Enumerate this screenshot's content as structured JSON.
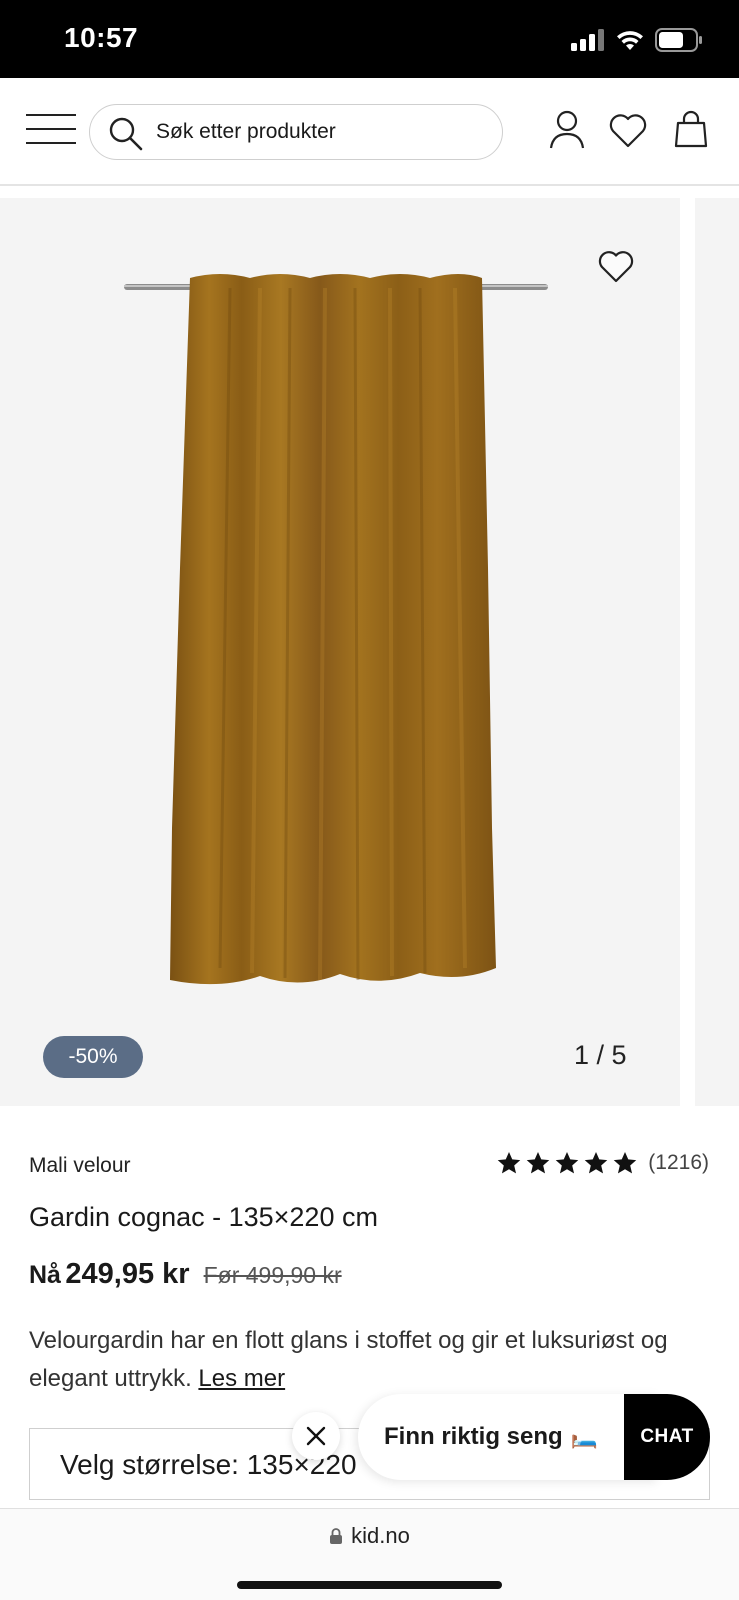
{
  "status_bar": {
    "time": "10:57"
  },
  "header": {
    "search_placeholder": "Søk etter produkter"
  },
  "gallery": {
    "discount": "-50%",
    "pager": "1 / 5"
  },
  "product": {
    "brand": "Mali velour",
    "rating_value": 5,
    "rating_count": "(1216)",
    "title": "Gardin cognac - 135×220 cm",
    "price_now_label": "Nå",
    "price_now": "249,95 kr",
    "price_before": "Før 499,90 kr",
    "description": "Velourgardin har en flott glans i stoffet og gir et luksuriøst og elegant uttrykk.",
    "read_more": "Les mer",
    "size_select_text": "Velg størrelse: 135×220"
  },
  "floating": {
    "finn_label": "Finn riktig seng",
    "finn_emoji": "🛏️",
    "chat_label": "CHAT"
  },
  "browser": {
    "url": "kid.no"
  },
  "colors": {
    "badge": "#5b6d86",
    "curtain": "#9a6a1c",
    "chat_bg": "#000000"
  }
}
